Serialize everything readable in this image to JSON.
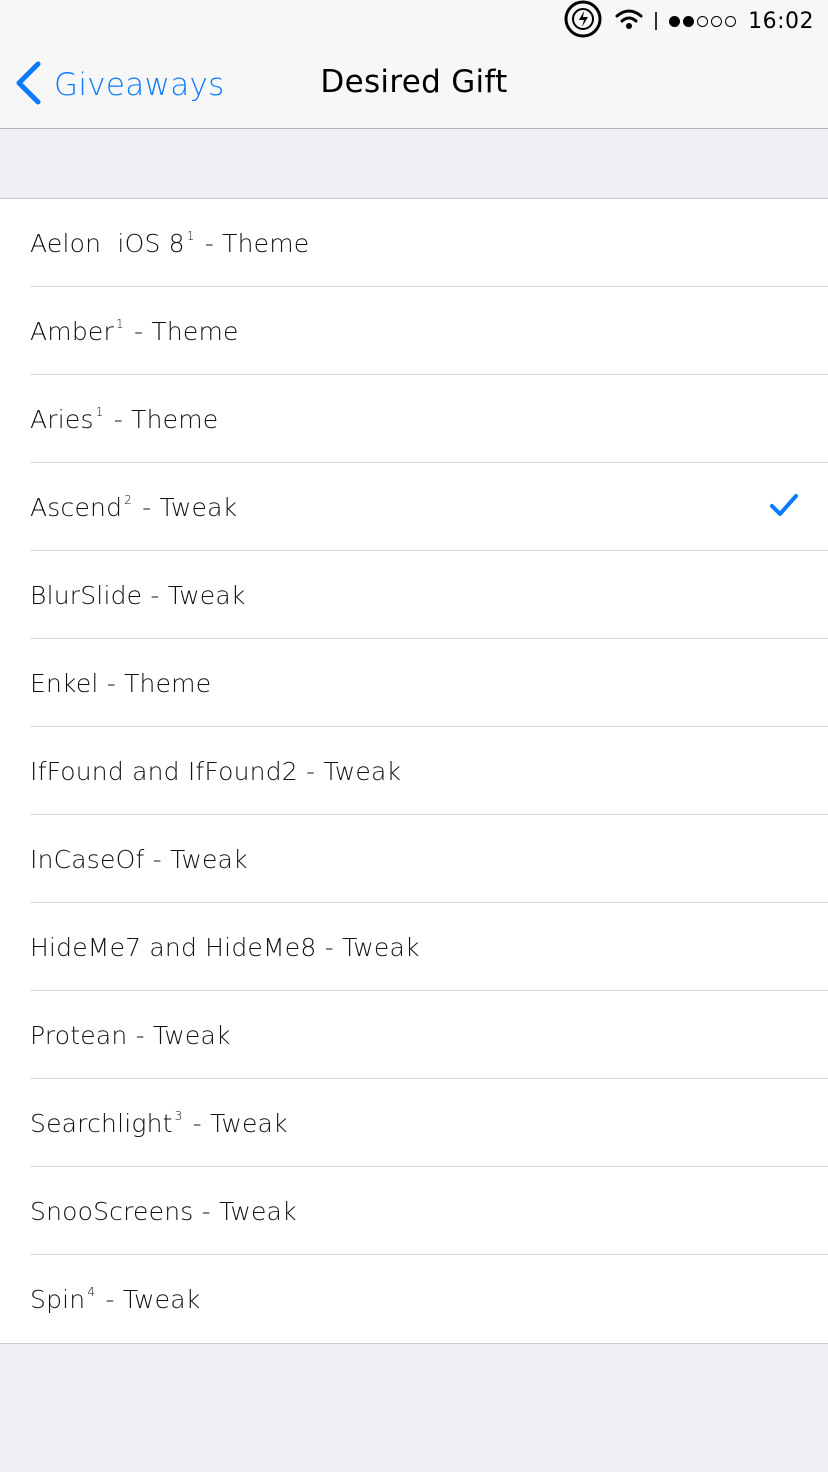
{
  "status_bar": {
    "time": "16:02",
    "signal_strength": 2,
    "signal_max": 5,
    "icons": [
      "battery-saver-icon",
      "wifi-icon"
    ]
  },
  "nav": {
    "back_label": "Giveaways",
    "title": "Desired Gift"
  },
  "accent_color": "#0a7aff",
  "items": [
    {
      "name": "Aelon  iOS 8",
      "sup": "1",
      "suffix": " - Theme",
      "selected": false
    },
    {
      "name": "Amber",
      "sup": "1",
      "suffix": " - Theme",
      "selected": false
    },
    {
      "name": "Aries",
      "sup": "1",
      "suffix": " - Theme",
      "selected": false
    },
    {
      "name": "Ascend",
      "sup": "2",
      "suffix": " - Tweak",
      "selected": true
    },
    {
      "name": "BlurSlide",
      "sup": "",
      "suffix": " - Tweak",
      "selected": false
    },
    {
      "name": "Enkel",
      "sup": "",
      "suffix": " - Theme",
      "selected": false
    },
    {
      "name": "IfFound and IfFound2",
      "sup": "",
      "suffix": " - Tweak",
      "selected": false
    },
    {
      "name": "InCaseOf",
      "sup": "",
      "suffix": " - Tweak",
      "selected": false
    },
    {
      "name": "HideMe7 and HideMe8",
      "sup": "",
      "suffix": " - Tweak",
      "selected": false
    },
    {
      "name": "Protean",
      "sup": "",
      "suffix": " - Tweak",
      "selected": false
    },
    {
      "name": "Searchlight",
      "sup": "3",
      "suffix": " - Tweak",
      "selected": false
    },
    {
      "name": "SnooScreens",
      "sup": "",
      "suffix": " - Tweak",
      "selected": false
    },
    {
      "name": "Spin",
      "sup": "4",
      "suffix": " - Tweak",
      "selected": false
    }
  ]
}
